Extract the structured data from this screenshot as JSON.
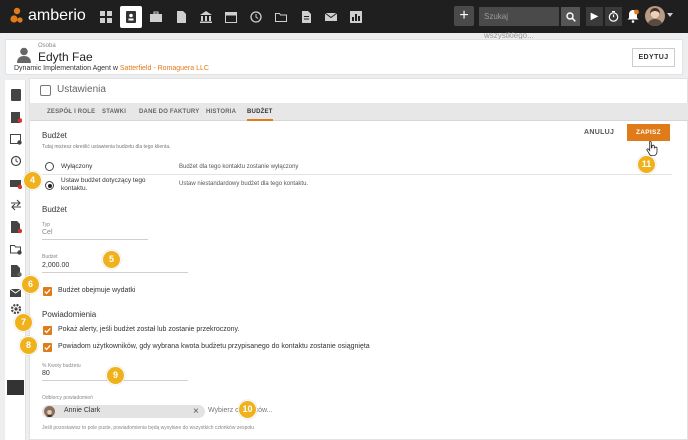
{
  "topbar": {
    "brand": "amberio",
    "search_placeholder": "Szukaj wszystkiego...",
    "plus_label": "+",
    "nav_icons": [
      "dashboard-icon",
      "contacts-icon",
      "briefcase-icon",
      "document-icon",
      "bank-icon",
      "calendar-icon",
      "history-icon",
      "folder-icon",
      "file-icon",
      "mail-icon",
      "chart-icon"
    ]
  },
  "header": {
    "label": "Osoba",
    "name": "Edyth Fae",
    "role_prefix": "Dynamic Implementation Agent w ",
    "company": "Satterfield - Romaguera LLC",
    "edit_label": "EDYTUJ"
  },
  "settings": {
    "title": "Ustawienia",
    "tabs": [
      "ZESPÓŁ I ROLE",
      "STAWKI",
      "DANE DO FAKTURY",
      "HISTORIA",
      "BUDŻET"
    ],
    "active_tab": "BUDŻET"
  },
  "budget": {
    "section_title": "Budżet",
    "section_desc": "Tutaj możesz określić ustawienia budżetu dla tego klienta.",
    "cancel_label": "ANULUJ",
    "save_label": "ZAPISZ",
    "options": [
      {
        "label": "Wyłączony",
        "desc": "Budżet dla tego kontaktu zostanie wyłączony",
        "selected": false
      },
      {
        "label": "Ustaw budżet dotyczący tego kontaktu.",
        "desc": "Ustaw niestandardowy budżet dla tego kontaktu.",
        "selected": true
      }
    ],
    "sub_title": "Budżet",
    "type_label": "Typ",
    "type_value": "Cel",
    "amount_label": "Budżet",
    "amount_value": "2,000.00",
    "expenses_label": "Budżet obejmuje wydatki",
    "expenses_checked": true
  },
  "notifications": {
    "title": "Powiadomienia",
    "alert_label": "Pokaż alerty, jeśli budżet został lub zostanie przekroczony.",
    "alert_checked": true,
    "notify_label": "Powiadom użytkowników, gdy wybrana kwota budżetu przypisanego do kontaktu zostanie osiągnięta",
    "notify_checked": true,
    "percent_label": "% Kwoty budżetu",
    "percent_value": "80",
    "recipients_label": "Odbiorcy powiadomień",
    "recipient_name": "Annie Clark",
    "recipients_placeholder": "Wybierz odbiorców...",
    "hint": "Jeśli pozostawisz to pole puste, powiadomienia będą wysyłane do wszystkich członków zespołu"
  },
  "badges": [
    "4",
    "5",
    "6",
    "7",
    "8",
    "9",
    "10",
    "11"
  ],
  "colors": {
    "accent": "#e07b1a",
    "badge": "#f0b21c",
    "topbar": "#1f1f1f"
  }
}
